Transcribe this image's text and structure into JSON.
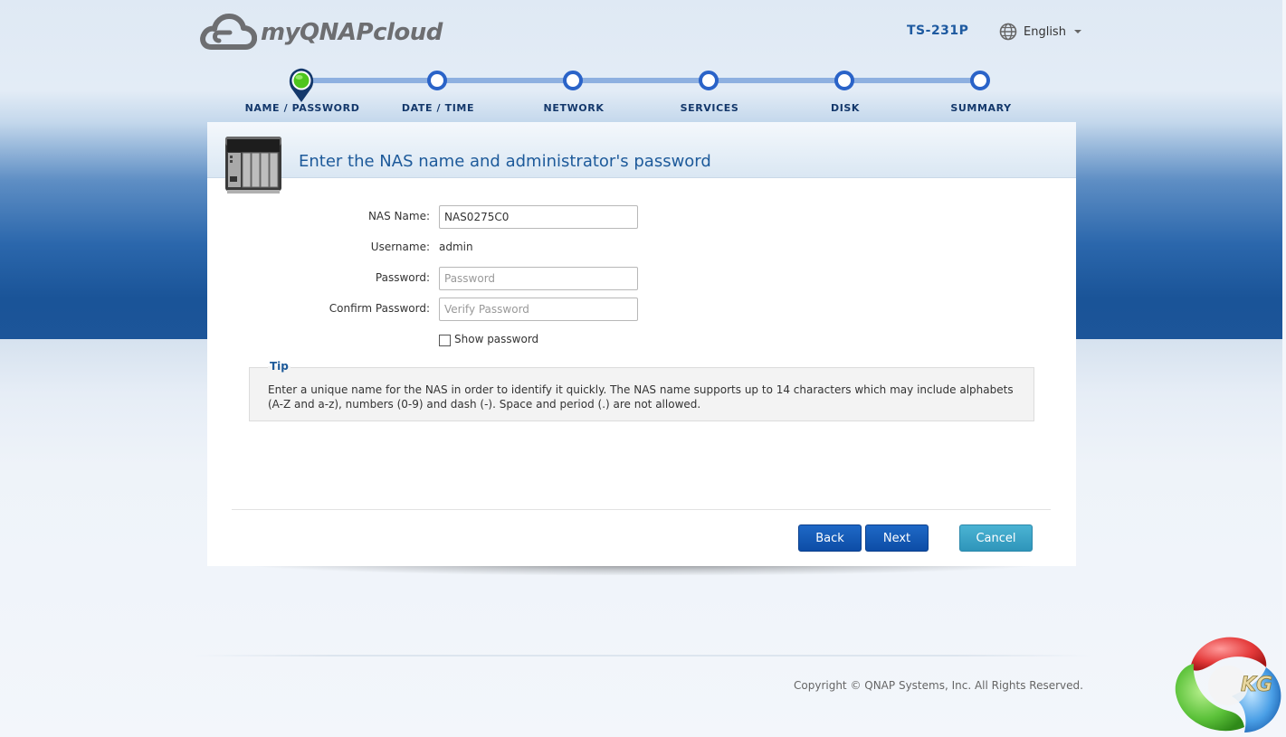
{
  "header": {
    "brand": "myQNAPcloud",
    "model": "TS-231P",
    "language": "English"
  },
  "steps": [
    {
      "label": "NAME / PASSWORD",
      "active": true
    },
    {
      "label": "DATE / TIME",
      "active": false
    },
    {
      "label": "NETWORK",
      "active": false
    },
    {
      "label": "SERVICES",
      "active": false
    },
    {
      "label": "DISK",
      "active": false
    },
    {
      "label": "SUMMARY",
      "active": false
    }
  ],
  "panel": {
    "title": "Enter the NAS name and administrator's password"
  },
  "form": {
    "nas_name_label": "NAS Name:",
    "nas_name_value": "NAS0275C0",
    "username_label": "Username:",
    "username_value": "admin",
    "password_label": "Password:",
    "password_placeholder": "Password",
    "confirm_label": "Confirm Password:",
    "confirm_placeholder": "Verify Password",
    "show_password_label": "Show password",
    "show_password_checked": false
  },
  "tip": {
    "title": "Tip",
    "text": "Enter a unique name for the NAS in order to identify it quickly. The NAS name supports up to 14 characters which may include alphabets (A-Z and a-z), numbers (0-9) and dash (-). Space and period (.) are not allowed."
  },
  "buttons": {
    "back": "Back",
    "next": "Next",
    "cancel": "Cancel"
  },
  "footer": {
    "copyright": "Copyright © QNAP Systems, Inc. All Rights Reserved."
  },
  "watermark": {
    "text": "KG"
  },
  "colors": {
    "accent_blue": "#1d5a9a",
    "step_blue": "#2a63c8",
    "step_active_green": "#4ec51d",
    "primary_button": "#0d4da6",
    "cancel_button": "#2f95ba"
  }
}
